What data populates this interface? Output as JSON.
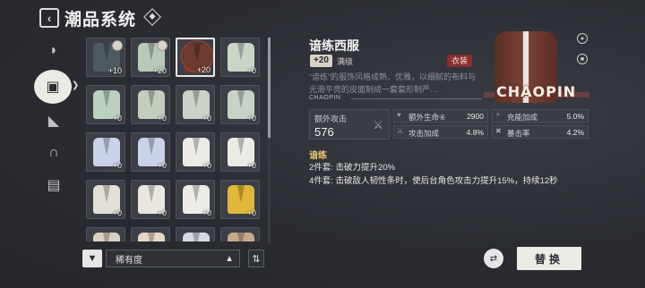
{
  "header": {
    "title": "潮品系统",
    "back_icon": "back-arrow-icon"
  },
  "rail": {
    "items": [
      {
        "icon": "cap-icon"
      },
      {
        "icon": "jacket-icon",
        "active": true
      },
      {
        "icon": "shoe-icon"
      },
      {
        "icon": "headphones-icon"
      },
      {
        "icon": "bag-icon"
      }
    ]
  },
  "grid": {
    "items": [
      {
        "count": "+10",
        "color": "#4d5a5e",
        "badge": true
      },
      {
        "count": "+20",
        "color": "#b9c9b9",
        "badge": true
      },
      {
        "count": "+20",
        "color": "#6e3a30",
        "selected": true,
        "ring": true
      },
      {
        "count": "+0",
        "color": "#c9d6c6"
      },
      {
        "count": "+0",
        "color": "#bcd0c0"
      },
      {
        "count": "+0",
        "color": "#c2cdbd"
      },
      {
        "count": "+0",
        "color": "#cdd2c9"
      },
      {
        "count": "+0",
        "color": "#c7d3c6"
      },
      {
        "count": "+0",
        "color": "#c9d2e8"
      },
      {
        "count": "+0",
        "color": "#c9d2e8"
      },
      {
        "count": "+0",
        "color": "#ecebe6"
      },
      {
        "count": "+0",
        "color": "#ecebe6"
      },
      {
        "count": "+0",
        "color": "#e2e0d6"
      },
      {
        "count": "+0",
        "color": "#e9e7e0"
      },
      {
        "count": "+0",
        "color": "#ecebe6"
      },
      {
        "count": "+0",
        "color": "#e0b83a"
      },
      {
        "count": "",
        "color": "#d7d0c2"
      },
      {
        "count": "",
        "color": "#e6d6c4"
      },
      {
        "count": "",
        "color": "#d6d9e0"
      },
      {
        "count": "",
        "color": "#c4a98a"
      }
    ]
  },
  "filter": {
    "sort_label": "稀有度",
    "filter_icon": "filter-icon",
    "order_icon": "sort-order-icon"
  },
  "detail": {
    "name": "谙练西服",
    "level": "+20",
    "level_text": "满级",
    "tag": "衣装",
    "description": "“谙练”的服饰风格成熟、优雅，以细腻的布料与光滑平亮的皮面制成一套套形制严…",
    "series": "CHAOPIN",
    "logo": "CHAOPIN",
    "main_stat": {
      "label": "额外攻击",
      "value": "576"
    },
    "sub_stats": [
      {
        "name": "额外生命④",
        "value": "2900"
      },
      {
        "name": "充能加成",
        "value": "5.0%"
      },
      {
        "name": "攻击加成",
        "value": "4.8%"
      },
      {
        "name": "暴击率",
        "value": "4.2%"
      }
    ],
    "set_name": "谙练",
    "set_effects": [
      "2件套: 击破力提升20%",
      "4件套: 击破敌人韧性条时，使后台角色攻击力提升15%，持续12秒"
    ]
  },
  "actions": {
    "replace_label": "替换"
  },
  "colors": {
    "accent_gold": "#e8c770",
    "tag_red": "#8a2f2f",
    "panel": "#3b3d44"
  }
}
